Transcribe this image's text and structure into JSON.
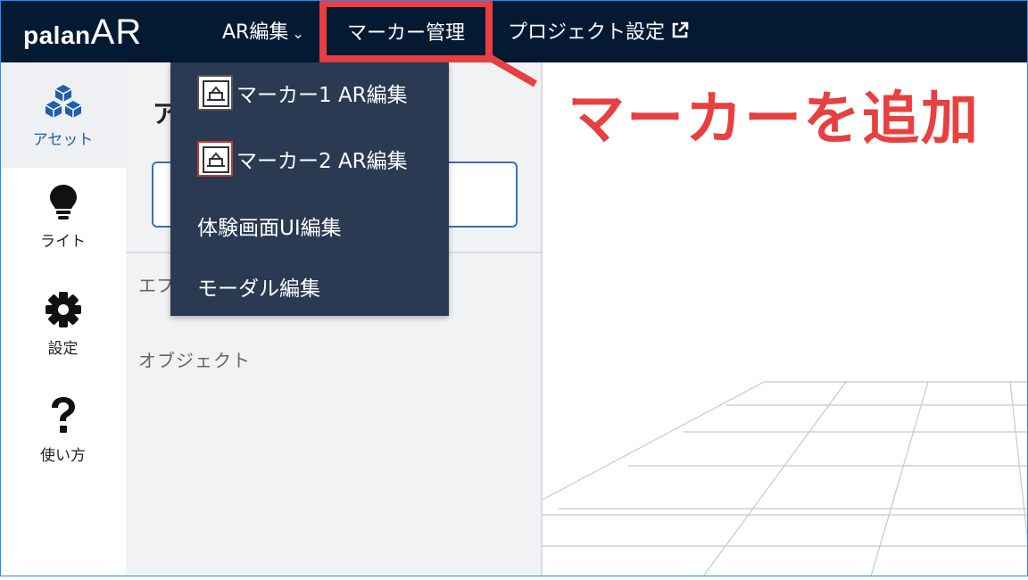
{
  "app": {
    "logo_main": "palan",
    "logo_accent": "AR"
  },
  "nav": {
    "ar_edit": "AR編集",
    "marker_manage": "マーカー管理",
    "project_settings": "プロジェクト設定"
  },
  "annotation": {
    "text": "マーカーを追加",
    "color": "#e84040"
  },
  "sidebar": {
    "items": [
      {
        "label": "アセット",
        "icon": "cubes-icon"
      },
      {
        "label": "ライト",
        "icon": "lightbulb-icon"
      },
      {
        "label": "設定",
        "icon": "gear-icon"
      },
      {
        "label": "使い方",
        "icon": "question-icon"
      }
    ]
  },
  "panel": {
    "title": "ア",
    "effect_label": "エフ",
    "object_label": "オブジェクト"
  },
  "dropdown": {
    "items": [
      {
        "label": "マーカー1 AR編集",
        "icon": "marker-icon"
      },
      {
        "label": "マーカー2 AR編集",
        "icon": "marker-icon"
      },
      {
        "label": "体験画面UI編集"
      },
      {
        "label": "モーダル編集"
      }
    ]
  },
  "colors": {
    "topbar": "#041a33",
    "dropdown": "#293a52",
    "accent_blue": "#1f5fae",
    "highlight_red": "#e84040"
  }
}
